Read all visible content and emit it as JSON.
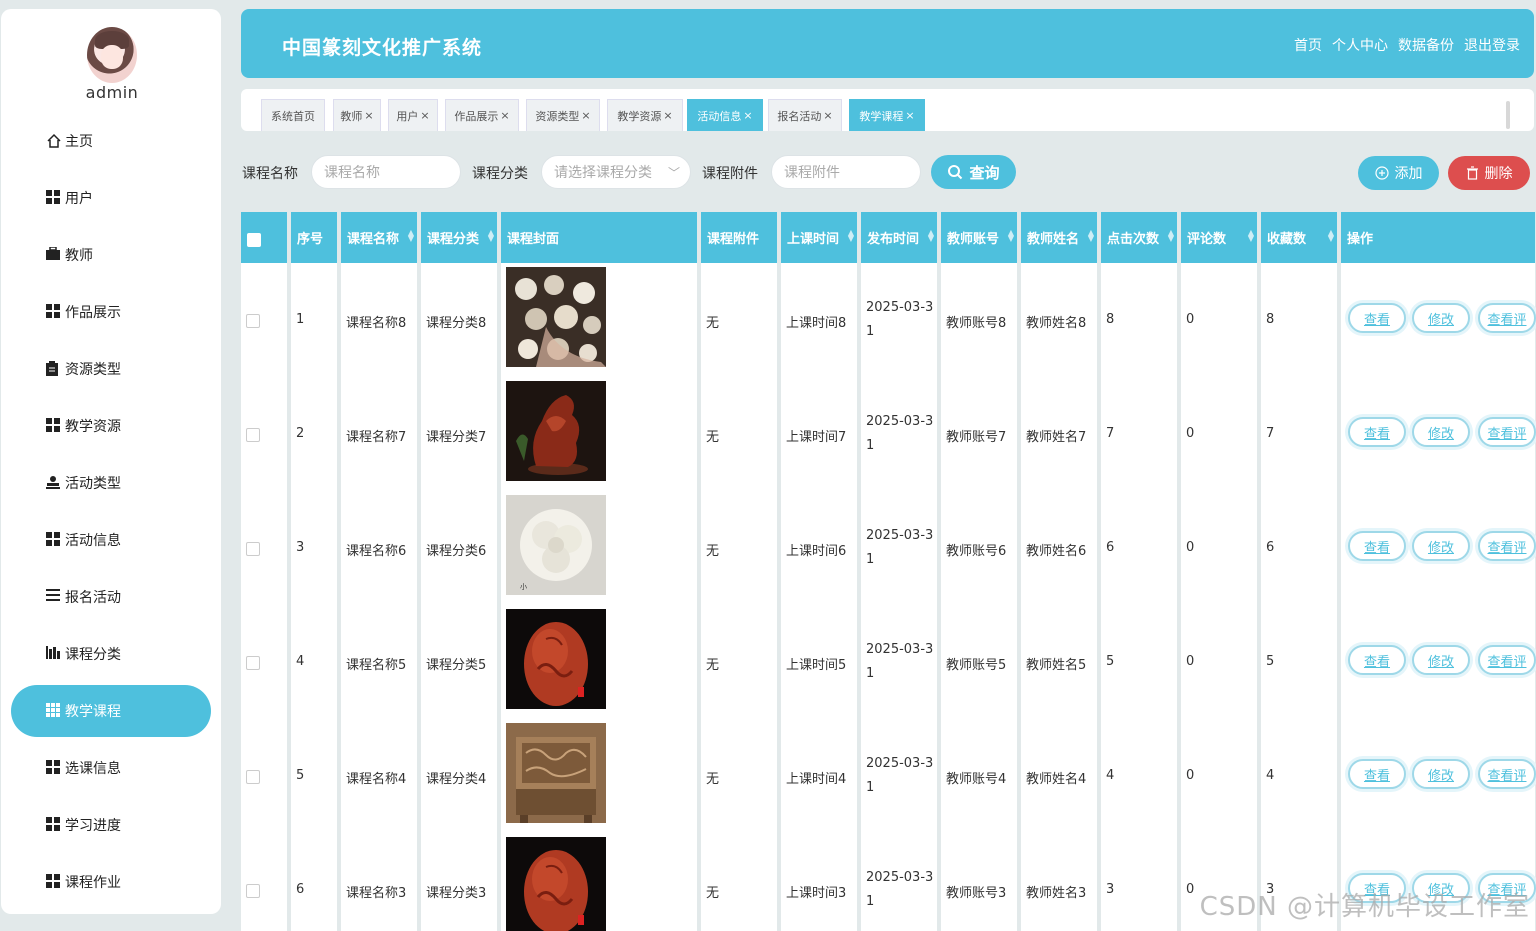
{
  "user": {
    "name": "admin"
  },
  "sidebar": {
    "items": [
      {
        "label": "主页",
        "icon": "home-icon"
      },
      {
        "label": "用户",
        "icon": "grid-icon"
      },
      {
        "label": "教师",
        "icon": "briefcase-icon"
      },
      {
        "label": "作品展示",
        "icon": "grid-icon"
      },
      {
        "label": "资源类型",
        "icon": "clipboard-icon"
      },
      {
        "label": "教学资源",
        "icon": "grid-icon"
      },
      {
        "label": "活动类型",
        "icon": "person-icon"
      },
      {
        "label": "活动信息",
        "icon": "grid-icon"
      },
      {
        "label": "报名活动",
        "icon": "list-icon"
      },
      {
        "label": "课程分类",
        "icon": "bar-chart-icon"
      },
      {
        "label": "教学课程",
        "icon": "table-icon",
        "active": true
      },
      {
        "label": "选课信息",
        "icon": "grid-icon"
      },
      {
        "label": "学习进度",
        "icon": "grid-icon"
      },
      {
        "label": "课程作业",
        "icon": "grid-icon"
      }
    ]
  },
  "header": {
    "title": "中国篆刻文化推广系统",
    "links": [
      "首页",
      "个人中心",
      "数据备份",
      "退出登录"
    ]
  },
  "tabs": [
    {
      "label": "系统首页",
      "closable": false
    },
    {
      "label": "教师",
      "closable": true
    },
    {
      "label": "用户",
      "closable": true
    },
    {
      "label": "作品展示",
      "closable": true
    },
    {
      "label": "资源类型",
      "closable": true
    },
    {
      "label": "教学资源",
      "closable": true
    },
    {
      "label": "活动信息",
      "closable": true,
      "active": true
    },
    {
      "label": "报名活动",
      "closable": true
    },
    {
      "label": "教学课程",
      "closable": true,
      "active": true
    }
  ],
  "search": {
    "course_name_label": "课程名称",
    "course_name_placeholder": "课程名称",
    "category_label": "课程分类",
    "category_placeholder": "请选择课程分类",
    "attachment_label": "课程附件",
    "attachment_placeholder": "课程附件",
    "query_button": "查询",
    "add_button": "添加",
    "delete_button": "删除"
  },
  "table": {
    "columns": [
      "序号",
      "课程名称",
      "课程分类",
      "课程封面",
      "课程附件",
      "上课时间",
      "发布时间",
      "教师账号",
      "教师姓名",
      "点击次数",
      "评论数",
      "收藏数",
      "操作"
    ],
    "rows": [
      {
        "no": "1",
        "name": "课程名称8",
        "category": "课程分类8",
        "cover": "beads",
        "attachment": "无",
        "class_time": "上课时间8",
        "publish_a": "2025-03-3",
        "publish_b": "1",
        "teacher_account": "教师账号8",
        "teacher_name": "教师姓名8",
        "clicks": "8",
        "comments": "0",
        "favorites": "8"
      },
      {
        "no": "2",
        "name": "课程名称7",
        "category": "课程分类7",
        "cover": "dragon",
        "attachment": "无",
        "class_time": "上课时间7",
        "publish_a": "2025-03-3",
        "publish_b": "1",
        "teacher_account": "教师账号7",
        "teacher_name": "教师姓名7",
        "clicks": "7",
        "comments": "0",
        "favorites": "7"
      },
      {
        "no": "3",
        "name": "课程名称6",
        "category": "课程分类6",
        "cover": "jade",
        "attachment": "无",
        "class_time": "上课时间6",
        "publish_a": "2025-03-3",
        "publish_b": "1",
        "teacher_account": "教师账号6",
        "teacher_name": "教师姓名6",
        "clicks": "6",
        "comments": "0",
        "favorites": "6"
      },
      {
        "no": "4",
        "name": "课程名称5",
        "category": "课程分类5",
        "cover": "red-stone",
        "attachment": "无",
        "class_time": "上课时间5",
        "publish_a": "2025-03-3",
        "publish_b": "1",
        "teacher_account": "教师账号5",
        "teacher_name": "教师姓名5",
        "clicks": "5",
        "comments": "0",
        "favorites": "5"
      },
      {
        "no": "5",
        "name": "课程名称4",
        "category": "课程分类4",
        "cover": "wood-box",
        "attachment": "无",
        "class_time": "上课时间4",
        "publish_a": "2025-03-3",
        "publish_b": "1",
        "teacher_account": "教师账号4",
        "teacher_name": "教师姓名4",
        "clicks": "4",
        "comments": "0",
        "favorites": "4"
      },
      {
        "no": "6",
        "name": "课程名称3",
        "category": "课程分类3",
        "cover": "red-stone",
        "attachment": "无",
        "class_time": "上课时间3",
        "publish_a": "2025-03-3",
        "publish_b": "1",
        "teacher_account": "教师账号3",
        "teacher_name": "教师姓名3",
        "clicks": "3",
        "comments": "0",
        "favorites": "3"
      }
    ],
    "actions": [
      "查看",
      "修改",
      "查看评"
    ]
  },
  "watermark": "CSDN @计算机毕设工作室",
  "colors": {
    "accent": "#4ec0dd",
    "danger": "#dd4e4e",
    "background": "#e2e9ea"
  }
}
